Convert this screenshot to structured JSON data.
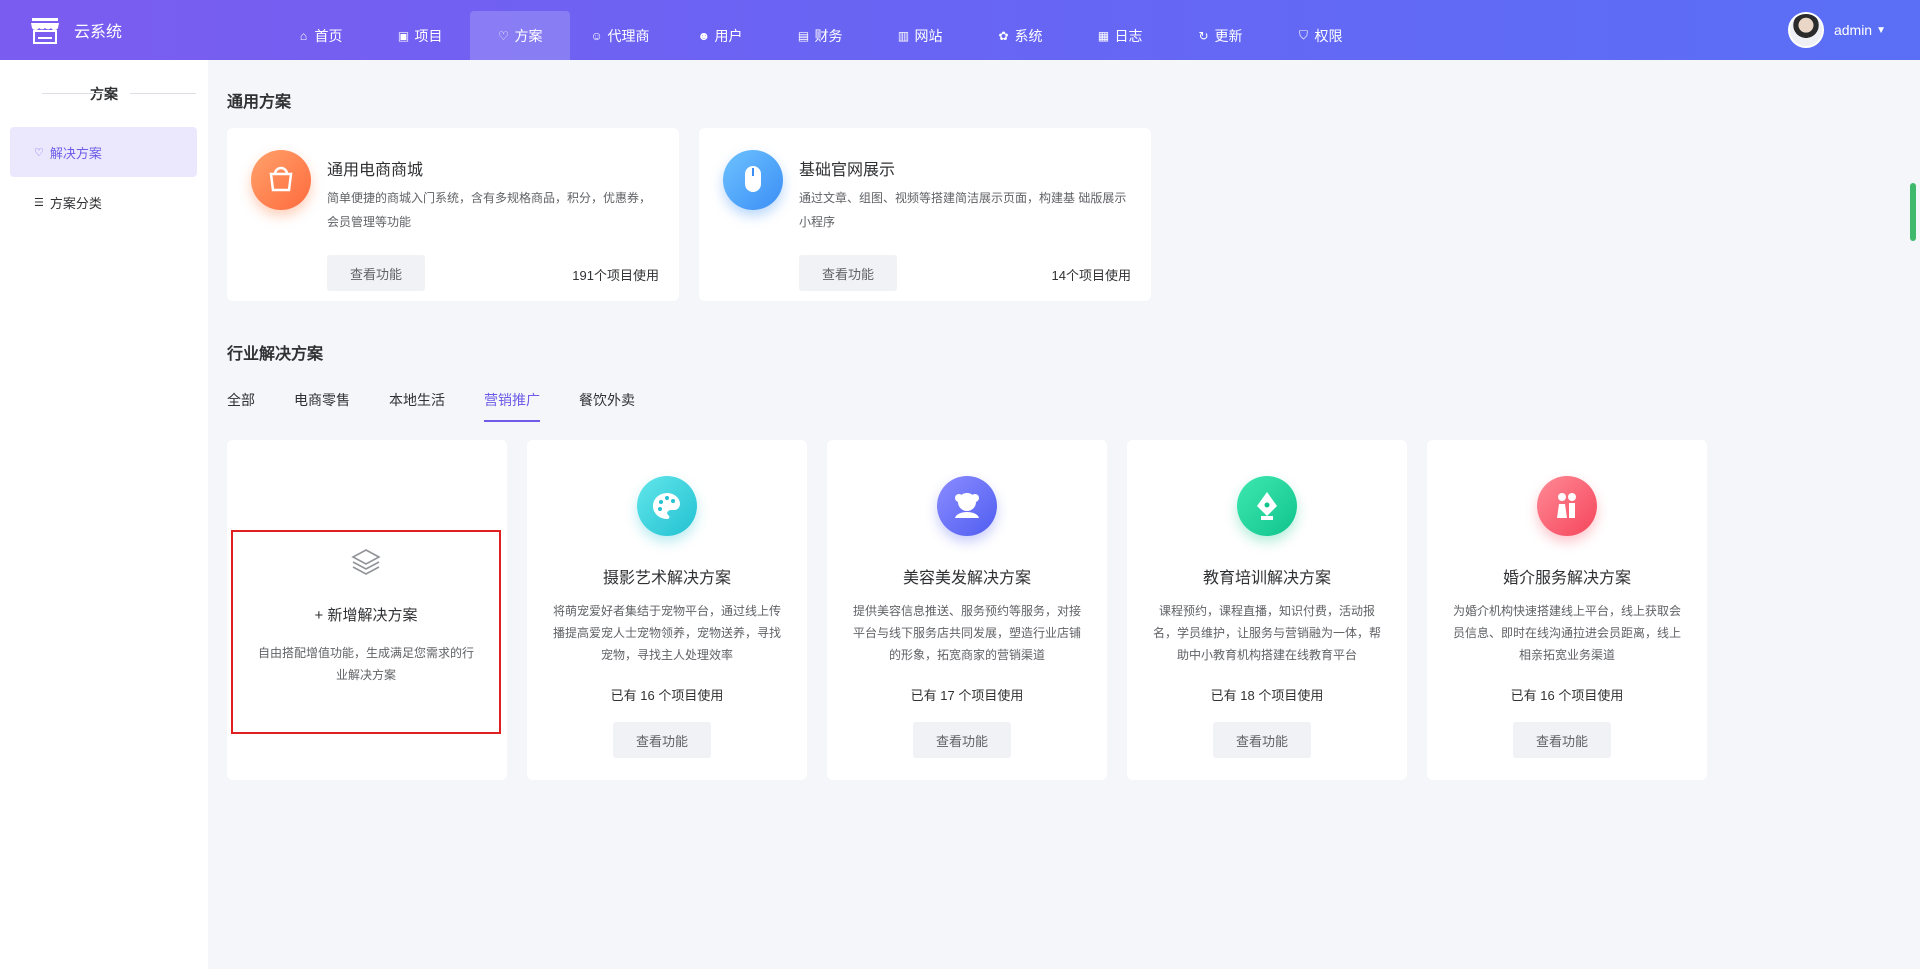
{
  "header": {
    "logo_text": "云系统",
    "nav": [
      {
        "label": "首页",
        "icon": "home-icon",
        "glyph": "⌂"
      },
      {
        "label": "项目",
        "icon": "briefcase-icon",
        "glyph": "▣"
      },
      {
        "label": "方案",
        "icon": "heart-icon",
        "glyph": "♡"
      },
      {
        "label": "代理商",
        "icon": "user-icon",
        "glyph": "☺"
      },
      {
        "label": "用户",
        "icon": "users-icon",
        "glyph": "☻"
      },
      {
        "label": "财务",
        "icon": "finance-icon",
        "glyph": "▤"
      },
      {
        "label": "网站",
        "icon": "website-icon",
        "glyph": "▥"
      },
      {
        "label": "系统",
        "icon": "settings-icon",
        "glyph": "✿"
      },
      {
        "label": "日志",
        "icon": "log-icon",
        "glyph": "▦"
      },
      {
        "label": "更新",
        "icon": "refresh-icon",
        "glyph": "↻"
      },
      {
        "label": "权限",
        "icon": "shield-icon",
        "glyph": "⛉"
      }
    ],
    "user_name": "admin"
  },
  "sidebar": {
    "title": "方案",
    "items": [
      {
        "label": "解决方案"
      },
      {
        "label": "方案分类"
      }
    ]
  },
  "general": {
    "title": "通用方案",
    "cards": [
      {
        "name": "通用电商商城",
        "desc": "简单便捷的商城入门系统，含有多规格商品，积分，优惠券，会员管理等功能",
        "button": "查看功能",
        "count": "191个项目使用"
      },
      {
        "name": "基础官网展示",
        "desc": "通过文章、组图、视频等搭建简洁展示页面，构建基 础版展示小程序",
        "button": "查看功能",
        "count": "14个项目使用"
      }
    ]
  },
  "industry": {
    "title": "行业解决方案",
    "tabs": [
      "全部",
      "电商零售",
      "本地生活",
      "营销推广",
      "餐饮外卖"
    ],
    "add": {
      "title": "+ 新增解决方案",
      "desc": "自由搭配增值功能，生成满足您需求的行业解决方案"
    },
    "cards": [
      {
        "name": "摄影艺术解决方案",
        "desc": "将萌宠爱好者集结于宠物平台，通过线上传播提高爱宠人士宠物领养，宠物送养，寻找宠物，寻找主人处理效率",
        "count": "已有 16 个项目使用",
        "button": "查看功能"
      },
      {
        "name": "美容美发解决方案",
        "desc": "提供美容信息推送、服务预约等服务，对接平台与线下服务店共同发展，塑造行业店铺的形象，拓宽商家的营销渠道",
        "count": "已有 17 个项目使用",
        "button": "查看功能"
      },
      {
        "name": "教育培训解决方案",
        "desc": "课程预约，课程直播，知识付费，活动报名，学员维护，让服务与营销融为一体，帮助中小教育机构搭建在线教育平台",
        "count": "已有 18 个项目使用",
        "button": "查看功能"
      },
      {
        "name": "婚介服务解决方案",
        "desc": "为婚介机构快速搭建线上平台，线上获取会员信息、即时在线沟通拉进会员距离，线上相亲拓宽业务渠道",
        "count": "已有 16 个项目使用",
        "button": "查看功能"
      }
    ]
  },
  "colors": {
    "accent": "#6c5ce7",
    "header_start": "#7b5cf0",
    "header_end": "#5a6ff6",
    "highlight_border": "#e02020"
  }
}
